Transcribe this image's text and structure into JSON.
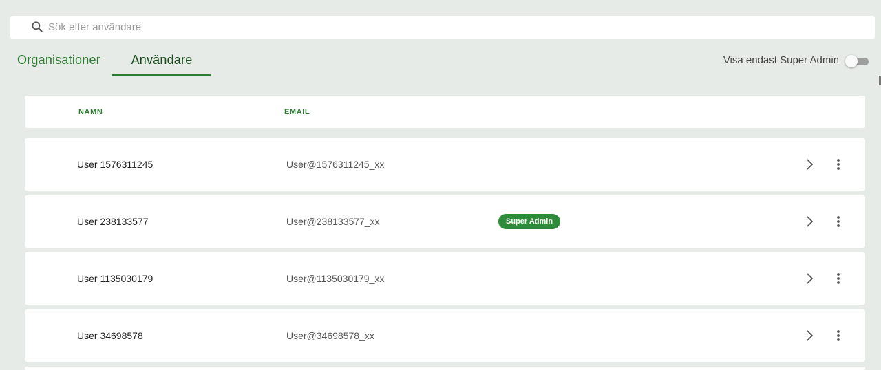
{
  "search": {
    "placeholder": "Sök efter användare",
    "icon": "search-icon"
  },
  "tabs": [
    {
      "label": "Organisationer",
      "active": false
    },
    {
      "label": "Användare",
      "active": true
    }
  ],
  "filter": {
    "label": "Visa endast Super Admin",
    "enabled": false
  },
  "table": {
    "columns": [
      "NAMN",
      "EMAIL"
    ],
    "rows": [
      {
        "name": "User 1576311245",
        "email": "User@1576311245_xx",
        "badge": ""
      },
      {
        "name": "User 238133577",
        "email": "User@238133577_xx",
        "badge": "Super Admin"
      },
      {
        "name": "User 1135030179",
        "email": "User@1135030179_xx",
        "badge": ""
      },
      {
        "name": "User 34698578",
        "email": "User@34698578_xx",
        "badge": ""
      }
    ]
  },
  "colors": {
    "accent": "#2e7d32",
    "badge": "#2e8b3a",
    "background": "#e6ebe7"
  }
}
